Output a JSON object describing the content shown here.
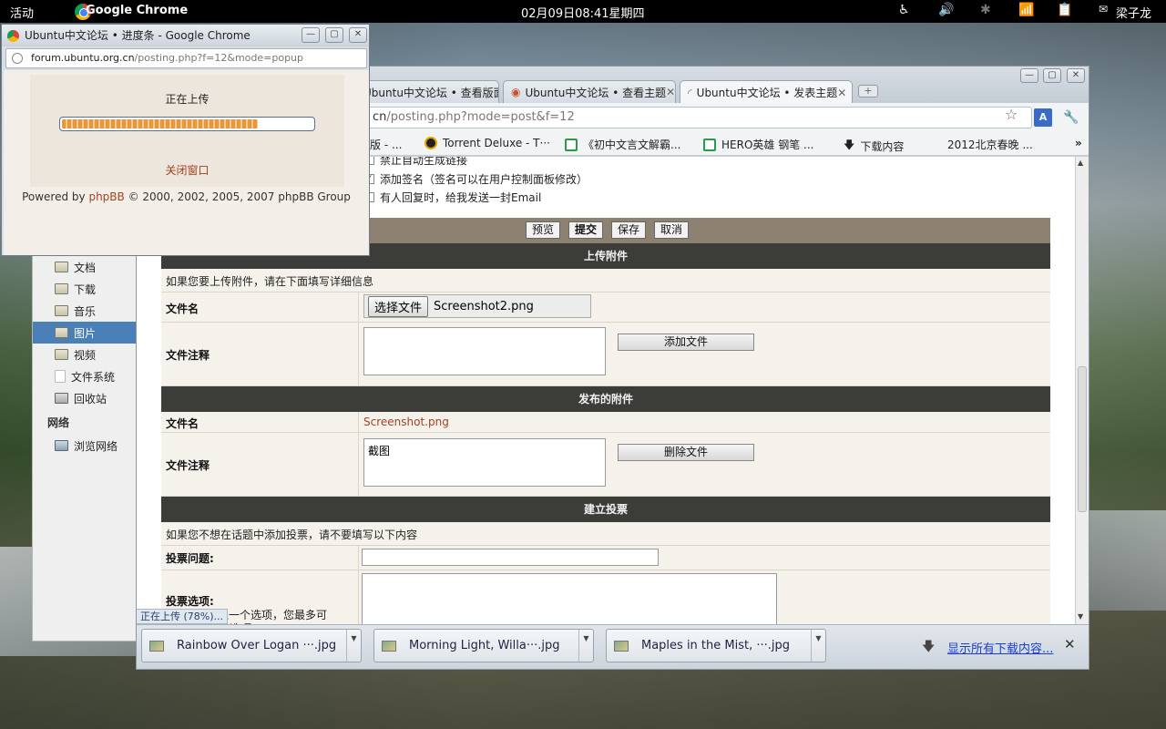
{
  "top_panel": {
    "activities": "活动",
    "app_name": "Google Chrome",
    "clock": "02月09日08:41星期四",
    "user": "梁子龙"
  },
  "file_manager": {
    "items": [
      {
        "label": "文档",
        "icon": "folder-documents-icon"
      },
      {
        "label": "下载",
        "icon": "folder-download-icon"
      },
      {
        "label": "音乐",
        "icon": "folder-music-icon"
      },
      {
        "label": "图片",
        "icon": "folder-pictures-icon",
        "selected": true
      },
      {
        "label": "视频",
        "icon": "folder-videos-icon"
      },
      {
        "label": "文件系统",
        "icon": "filesystem-icon"
      },
      {
        "label": "回收站",
        "icon": "trash-icon"
      }
    ],
    "network_heading": "网络",
    "network_item": "浏览网络"
  },
  "browser": {
    "tabs": [
      {
        "label": "Ubuntu中文论坛 • 查看版面"
      },
      {
        "label": "Ubuntu中文论坛 • 查看主题"
      },
      {
        "label": "Ubuntu中文论坛 • 发表主题",
        "active": true
      }
    ],
    "url_host": "cn",
    "url_path": "/posting.php?mode=post&f=12",
    "bookmarks": [
      {
        "label": "版 - ..."
      },
      {
        "label": "Torrent Deluxe - T···"
      },
      {
        "label": "《初中文言文解霸..."
      },
      {
        "label": "HERO英雄 钢笔 ..."
      },
      {
        "label": "下载内容"
      },
      {
        "label": "2012北京春晚 ..."
      }
    ],
    "status_text": "正在上传 (78%)..."
  },
  "form": {
    "option_1": "禁止自动生成链接",
    "option_2": "添加签名（签名可以在用户控制面板修改）",
    "option_3": "有人回复时，给我发送一封Email",
    "buttons": {
      "preview": "预览",
      "submit": "提交",
      "save": "保存",
      "cancel": "取消"
    },
    "upload": {
      "heading": "上传附件",
      "note": "如果您要上传附件，请在下面填写详细信息",
      "filename_label": "文件名",
      "choose_button": "选择文件",
      "chosen_file": "Screenshot2.png",
      "comment_label": "文件注释",
      "comment_value": "",
      "add_button": "添加文件"
    },
    "posted": {
      "heading": "发布的附件",
      "filename_label": "文件名",
      "file_link": "Screenshot.png",
      "comment_label": "文件注释",
      "comment_value": "截图",
      "delete_button": "删除文件"
    },
    "poll": {
      "heading": "建立投票",
      "note": "如果您不想在话题中添加投票，请不要填写以下内容",
      "question_label": "投票问题:",
      "options_label": "投票选项:",
      "options_hint_1": "输入一个选项，您最多可",
      "options_hint_2": "选项"
    }
  },
  "downloads": {
    "items": [
      {
        "name": "Rainbow Over Logan ···.jpg"
      },
      {
        "name": "Morning Light, Willa···.jpg"
      },
      {
        "name": "Maples in the Mist, ···.jpg"
      }
    ],
    "show_all": "显示所有下载内容...",
    "close": "✕"
  },
  "popup": {
    "title": "Ubuntu中文论坛 • 进度条 - Google Chrome",
    "url_host": "forum.ubuntu.org.cn",
    "url_path": "/posting.php?f=12&mode=popup",
    "uploading": "正在上传",
    "progress_percent": 78,
    "close_window": "关闭窗口",
    "footer_prefix": "Powered by ",
    "footer_link": "phpBB",
    "footer_suffix": " © 2000, 2002, 2005, 2007 phpBB Group"
  }
}
